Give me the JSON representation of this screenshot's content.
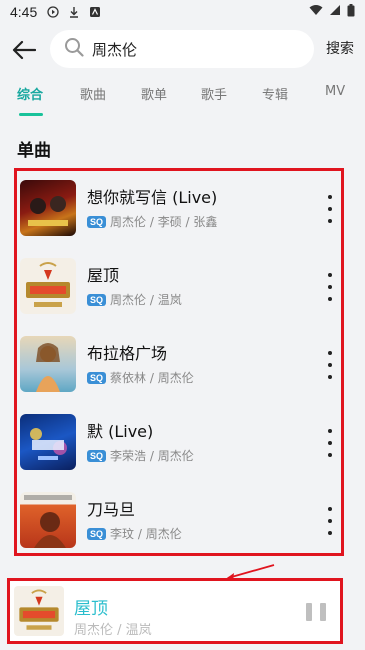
{
  "status_bar": {
    "time": "4:45"
  },
  "search": {
    "query": "周杰伦",
    "button_label": "搜索"
  },
  "tabs": [
    {
      "label": "综合"
    },
    {
      "label": "歌曲"
    },
    {
      "label": "歌单"
    },
    {
      "label": "歌手"
    },
    {
      "label": "专辑"
    },
    {
      "label": "MV"
    }
  ],
  "active_tab": "综合",
  "section_title": "单曲",
  "songs": [
    {
      "title": "想你就写信 (Live)",
      "artists": "周杰伦 / 李硕 / 张鑫",
      "quality": "SQ"
    },
    {
      "title": "屋顶",
      "artists": "周杰伦 / 温岚",
      "quality": "SQ"
    },
    {
      "title": "布拉格广场",
      "artists": "蔡依林 / 周杰伦",
      "quality": "SQ"
    },
    {
      "title": "默 (Live)",
      "artists": "李荣浩 / 周杰伦",
      "quality": "SQ"
    },
    {
      "title": "刀马旦",
      "artists": "李玟 / 周杰伦",
      "quality": "SQ"
    }
  ],
  "now_playing": {
    "title": "屋顶",
    "artist": "周杰伦 / 温岚"
  },
  "colors": {
    "accent": "#19a8a0",
    "highlight_border": "#e0141e",
    "playing_title": "#2bbecd",
    "sq_badge": "#3a8fd6"
  }
}
